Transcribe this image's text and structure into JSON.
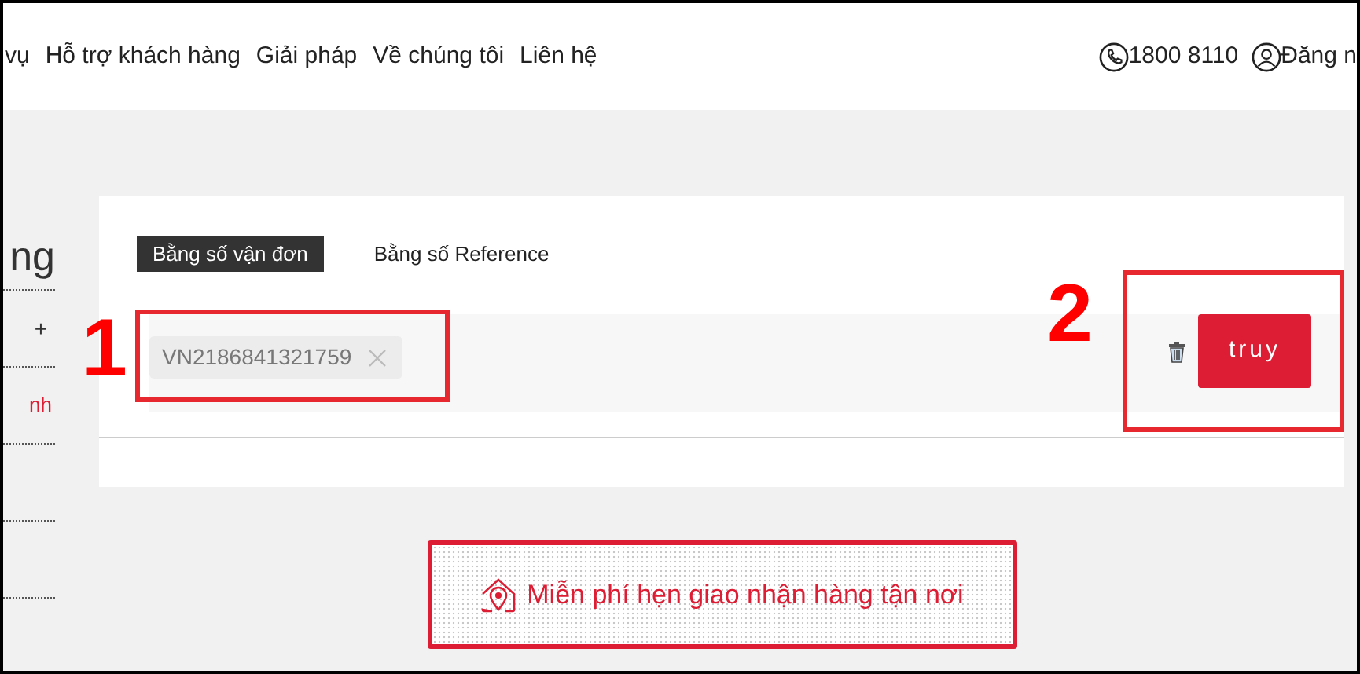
{
  "nav": {
    "links": [
      "vụ",
      "Hỗ trợ khách hàng",
      "Giải pháp",
      "Về chúng tôi",
      "Liên hệ"
    ],
    "phone": "1800 8110",
    "login": "Đăng n"
  },
  "sidebar": {
    "heading": "ng",
    "items": [
      {
        "kind": "plus",
        "label": "+"
      },
      {
        "kind": "link",
        "label": "nh"
      }
    ]
  },
  "tabs": [
    {
      "label": "Bằng số vận đơn",
      "selected": true
    },
    {
      "label": "Bằng số Reference",
      "selected": false
    }
  ],
  "tracking": {
    "chips": [
      {
        "value": "VN2186841321759"
      }
    ],
    "search_button": "truy"
  },
  "banner": {
    "text": "Miễn phí hẹn giao nhận hàng tận nơi"
  },
  "annotations": [
    {
      "label": "1"
    },
    {
      "label": "2"
    }
  ]
}
